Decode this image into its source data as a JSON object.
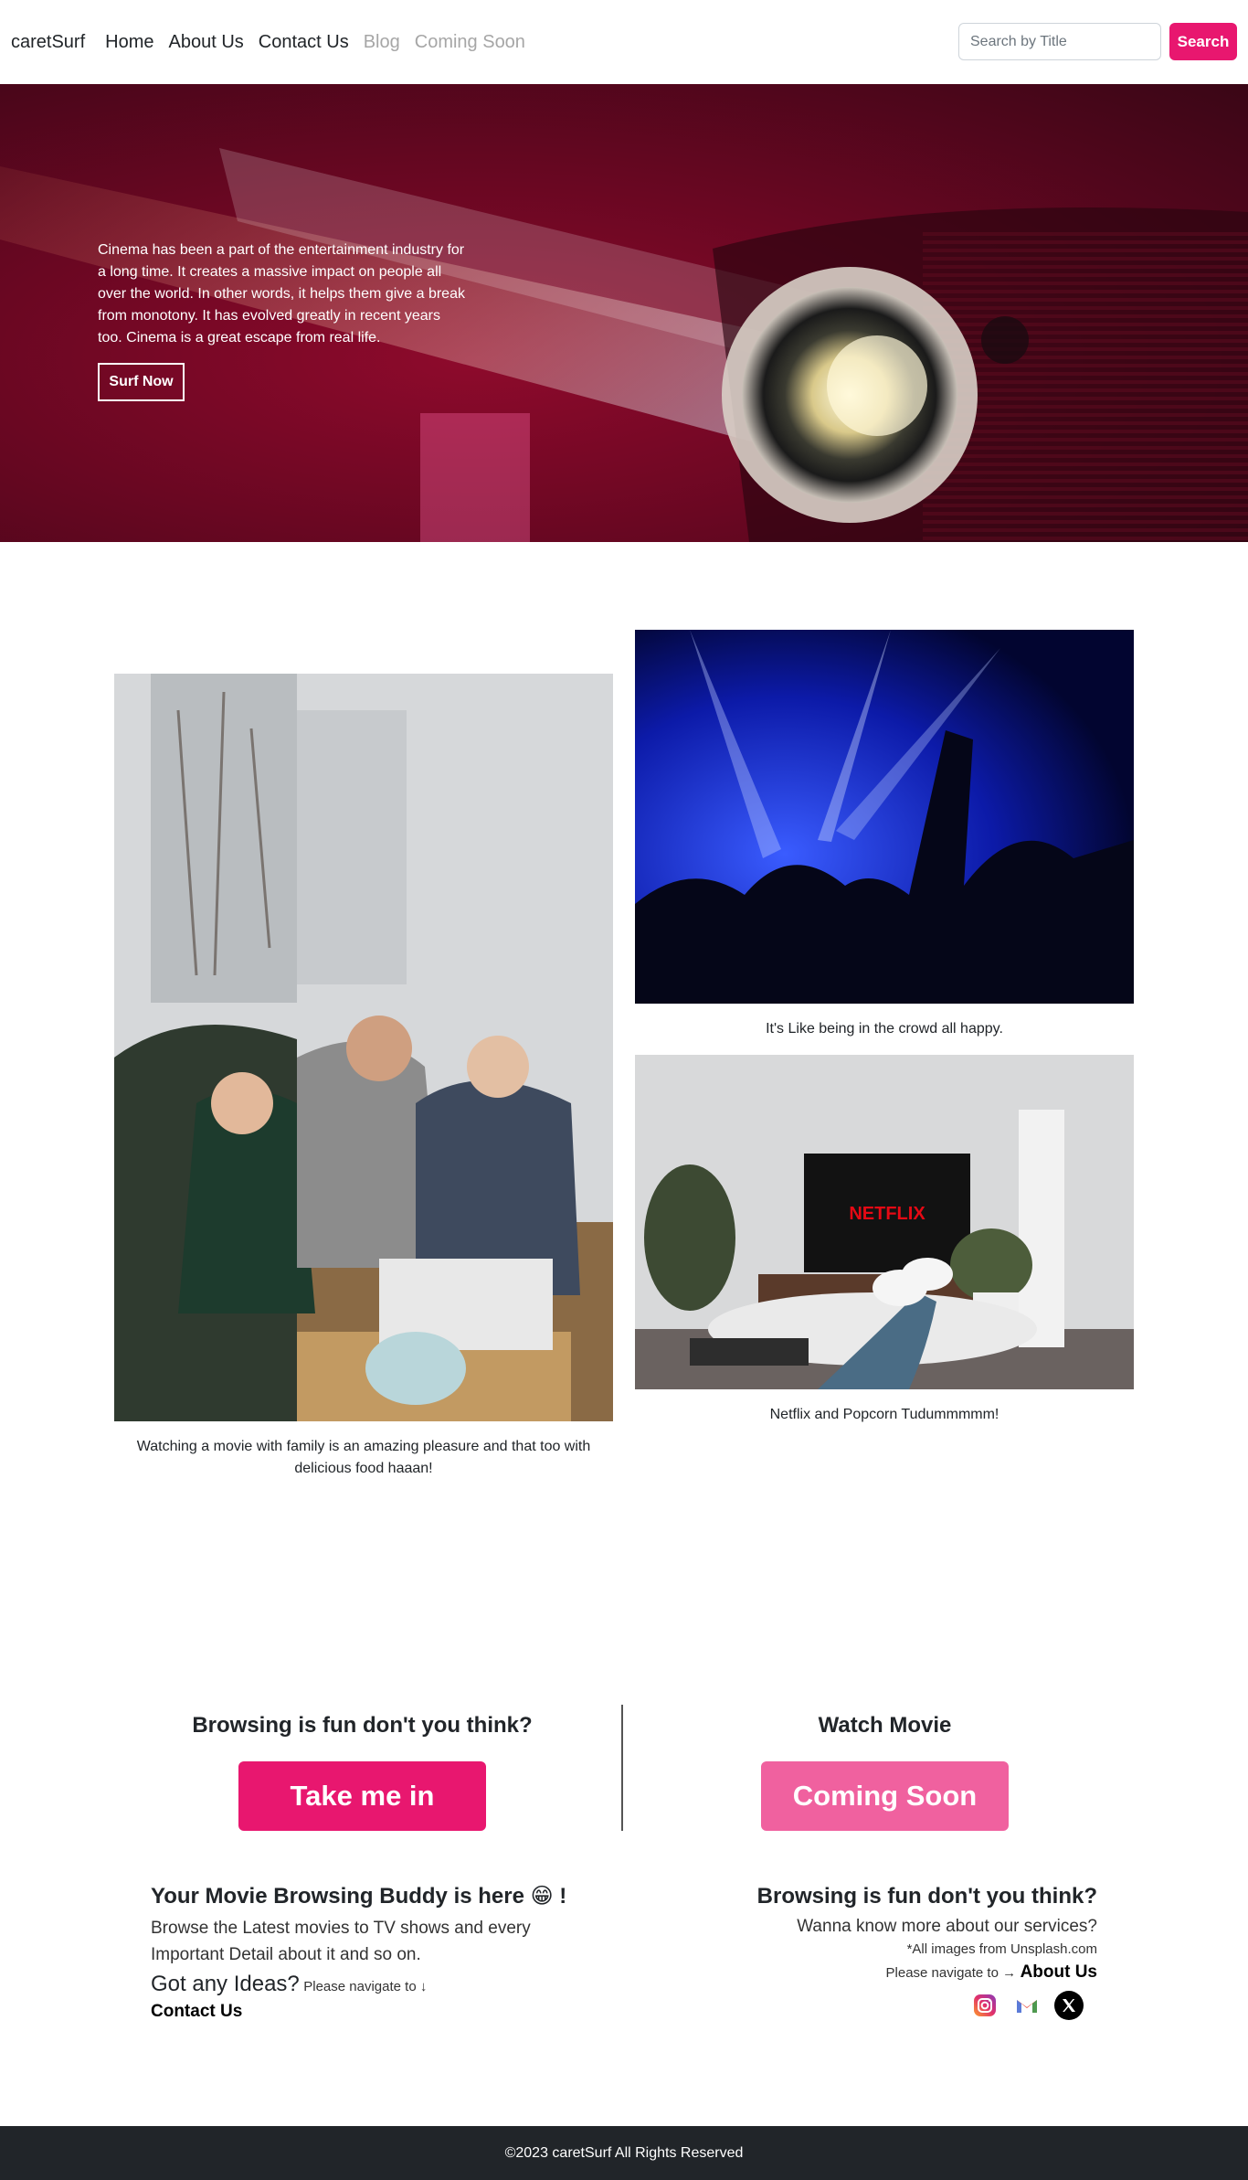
{
  "nav": {
    "brand": "caretSurf",
    "links": [
      {
        "label": "Home",
        "disabled": false
      },
      {
        "label": "About Us",
        "disabled": false
      },
      {
        "label": "Contact Us",
        "disabled": false
      },
      {
        "label": "Blog",
        "disabled": true
      },
      {
        "label": "Coming Soon",
        "disabled": true
      }
    ],
    "search_placeholder": "Search by Title",
    "search_label": "Search"
  },
  "hero": {
    "text": "Cinema has been a part of the entertainment industry for a long time. It creates a massive impact on people all over the world. In other words, it helps them give a break from monotony. It has evolved greatly in recent years too. Cinema is a great escape from real life.",
    "button_label": "Surf Now"
  },
  "gallery": {
    "family_caption": "Watching a movie with family is an amazing pleasure and that too with delicious food haaan!",
    "crowd_caption": "It's Like being in the crowd all happy.",
    "netflix_caption": "Netflix and Popcorn Tudummmmm!",
    "tv_logo_text": "NETFLIX"
  },
  "cta": {
    "left_heading": "Browsing is fun don't you think?",
    "left_button": "Take me in",
    "right_heading": "Watch Movie",
    "right_button": "Coming Soon"
  },
  "info": {
    "left_title": "Your Movie Browsing Buddy is here 😁 !",
    "left_body": "Browse the Latest movies to TV shows and every Important Detail about it and so on.",
    "ideas_title": "Got any Ideas?",
    "ideas_note": "Please navigate to ↓",
    "contact_link": "Contact Us",
    "right_title": "Browsing is fun don't you think?",
    "right_body": "Wanna know more about our services?",
    "credit": "*All images from Unsplash.com",
    "navigate_note": "Please navigate to →",
    "about_link": "About Us",
    "socials": [
      {
        "icon": "instagram-icon",
        "label": "Instagram"
      },
      {
        "icon": "gmail-icon",
        "label": "Gmail"
      },
      {
        "icon": "x-icon",
        "label": "X"
      }
    ]
  },
  "footer": {
    "copyright": "©2023 caretSurf All Rights Reserved"
  },
  "colors": {
    "accent": "#e8176f",
    "accent_light": "#f0619f",
    "footer_bg": "#212529"
  }
}
